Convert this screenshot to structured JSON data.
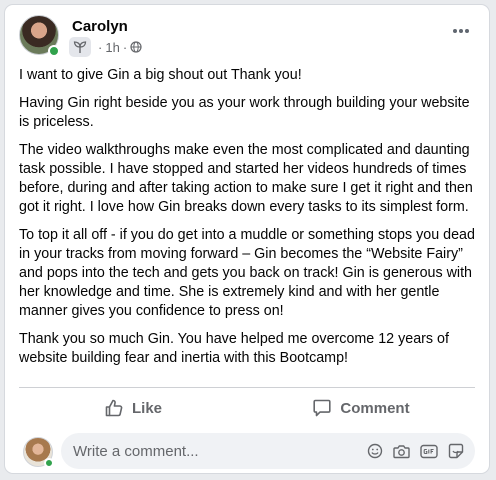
{
  "post": {
    "author": "Carolyn",
    "time": "1h",
    "separator": "·",
    "audience_icon": "globe-icon",
    "badge_icon": "seedling-icon",
    "more_icon": "more-horizontal-icon",
    "paragraphs": [
      "I want to give Gin a big shout out Thank you!",
      "Having Gin right beside you as your work through building your website is priceless.",
      "The video walkthroughs make even the most complicated and daunting task possible.  I have stopped and started her videos hundreds of times before, during and after taking action to make sure I get it right and then got it right.  I love how Gin breaks down every tasks to its simplest form.",
      "To top it all off - if you do get into a muddle or something stops you dead in your tracks from moving forward – Gin becomes the “Website Fairy” and pops into the tech and gets you back on track! Gin is generous with her knowledge and time. She is extremely kind and with her gentle manner gives you confidence to press on!",
      "Thank you so much Gin. You have helped me overcome 12 years of website building fear and inertia with this Bootcamp!"
    ]
  },
  "actions": {
    "like_label": "Like",
    "comment_label": "Comment"
  },
  "comment_composer": {
    "placeholder": "Write a comment...",
    "value": "",
    "icons": [
      "emoji-icon",
      "camera-icon",
      "gif-icon",
      "sticker-icon"
    ]
  },
  "colors": {
    "online": "#31a24c",
    "muted_text": "#65676b",
    "input_bg": "#f0f2f5"
  }
}
